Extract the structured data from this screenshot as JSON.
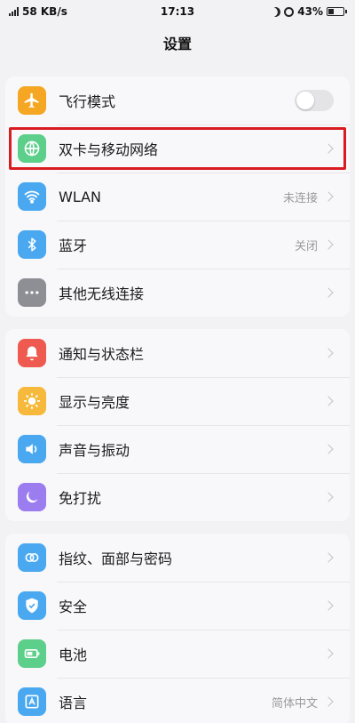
{
  "status_bar": {
    "network_speed": "58 KB/s",
    "time": "17:13",
    "battery_percent": "43%",
    "battery_level": 0.43
  },
  "header": {
    "title": "设置"
  },
  "groups": [
    {
      "items": [
        {
          "label": "飞行模式",
          "icon": "airplane-icon",
          "icon_color": "#f5a623",
          "control": "toggle",
          "toggle_on": false
        },
        {
          "label": "双卡与移动网络",
          "icon": "globe-icon",
          "icon_color": "#5ccf8a",
          "control": "chevron",
          "highlighted": true
        },
        {
          "label": "WLAN",
          "icon": "wifi-icon",
          "icon_color": "#4aa8f0",
          "control": "chevron",
          "value": "未连接"
        },
        {
          "label": "蓝牙",
          "icon": "bluetooth-icon",
          "icon_color": "#4aa8f0",
          "control": "chevron",
          "value": "关闭"
        },
        {
          "label": "其他无线连接",
          "icon": "more-icon",
          "icon_color": "#8e8e95",
          "control": "chevron"
        }
      ]
    },
    {
      "items": [
        {
          "label": "通知与状态栏",
          "icon": "notification-icon",
          "icon_color": "#ee5a4f",
          "control": "chevron"
        },
        {
          "label": "显示与亮度",
          "icon": "brightness-icon",
          "icon_color": "#f6b93b",
          "control": "chevron"
        },
        {
          "label": "声音与振动",
          "icon": "speaker-icon",
          "icon_color": "#4aa8f0",
          "control": "chevron"
        },
        {
          "label": "免打扰",
          "icon": "moon-icon",
          "icon_color": "#9b7df0",
          "control": "chevron"
        }
      ]
    },
    {
      "items": [
        {
          "label": "指纹、面部与密码",
          "icon": "fingerprint-face-icon",
          "icon_color": "#4aa8f0",
          "control": "chevron"
        },
        {
          "label": "安全",
          "icon": "shield-icon",
          "icon_color": "#4aa8f0",
          "control": "chevron"
        },
        {
          "label": "电池",
          "icon": "battery-icon",
          "icon_color": "#5ccf8a",
          "control": "chevron"
        },
        {
          "label": "语言",
          "icon": "language-icon",
          "icon_color": "#4aa8f0",
          "control": "chevron",
          "value": "简体中文"
        }
      ]
    }
  ],
  "colors": {
    "highlight_border": "#d91c21",
    "background": "#f2f2f4"
  }
}
